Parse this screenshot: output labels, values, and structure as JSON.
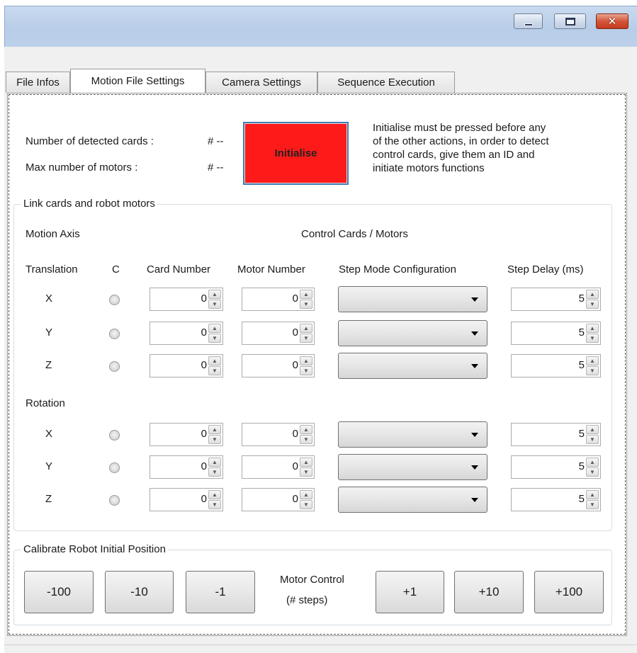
{
  "tabs": [
    "File Infos",
    "Motion File Settings",
    "Camera Settings",
    "Sequence Execution"
  ],
  "header": {
    "detected_cards_label": "Number of detected cards :",
    "detected_cards_value": "# --",
    "max_motors_label": "Max number of motors :",
    "max_motors_value": "# --",
    "initialise_label": "Initialise",
    "note_lines": [
      "Initialise must be pressed before any",
      "of the other actions, in order to detect",
      "control cards, give them an ID and",
      "initiate motors functions"
    ]
  },
  "link_group": {
    "title": "Link cards and robot motors",
    "motion_axis": "Motion Axis",
    "control_cards": "Control Cards / Motors",
    "headers": {
      "translation": "Translation",
      "c": "C",
      "card_number": "Card Number",
      "motor_number": "Motor Number",
      "step_mode": "Step Mode Configuration",
      "step_delay": "Step Delay (ms)"
    },
    "rotation_label": "Rotation",
    "translation_rows": [
      {
        "axis": "X",
        "card": "0",
        "motor": "0",
        "mode": "",
        "delay": "5"
      },
      {
        "axis": "Y",
        "card": "0",
        "motor": "0",
        "mode": "",
        "delay": "5"
      },
      {
        "axis": "Z",
        "card": "0",
        "motor": "0",
        "mode": "",
        "delay": "5"
      }
    ],
    "rotation_rows": [
      {
        "axis": "X",
        "card": "0",
        "motor": "0",
        "mode": "",
        "delay": "5"
      },
      {
        "axis": "Y",
        "card": "0",
        "motor": "0",
        "mode": "",
        "delay": "5"
      },
      {
        "axis": "Z",
        "card": "0",
        "motor": "0",
        "mode": "",
        "delay": "5"
      }
    ]
  },
  "calibrate": {
    "title": "Calibrate Robot Initial Position",
    "motor_control_line1": "Motor Control",
    "motor_control_line2": "(# steps)",
    "buttons_left": [
      "-100",
      "-10",
      "-1"
    ],
    "buttons_right": [
      "+1",
      "+10",
      "+100"
    ]
  },
  "colors": {
    "initialise_bg": "#ff1a1a",
    "titlebar": "#c3d6ee",
    "close_button": "#d4553a"
  },
  "icons": {
    "minimize": "minimize-icon",
    "maximize": "maximize-icon",
    "close": "close-icon"
  }
}
